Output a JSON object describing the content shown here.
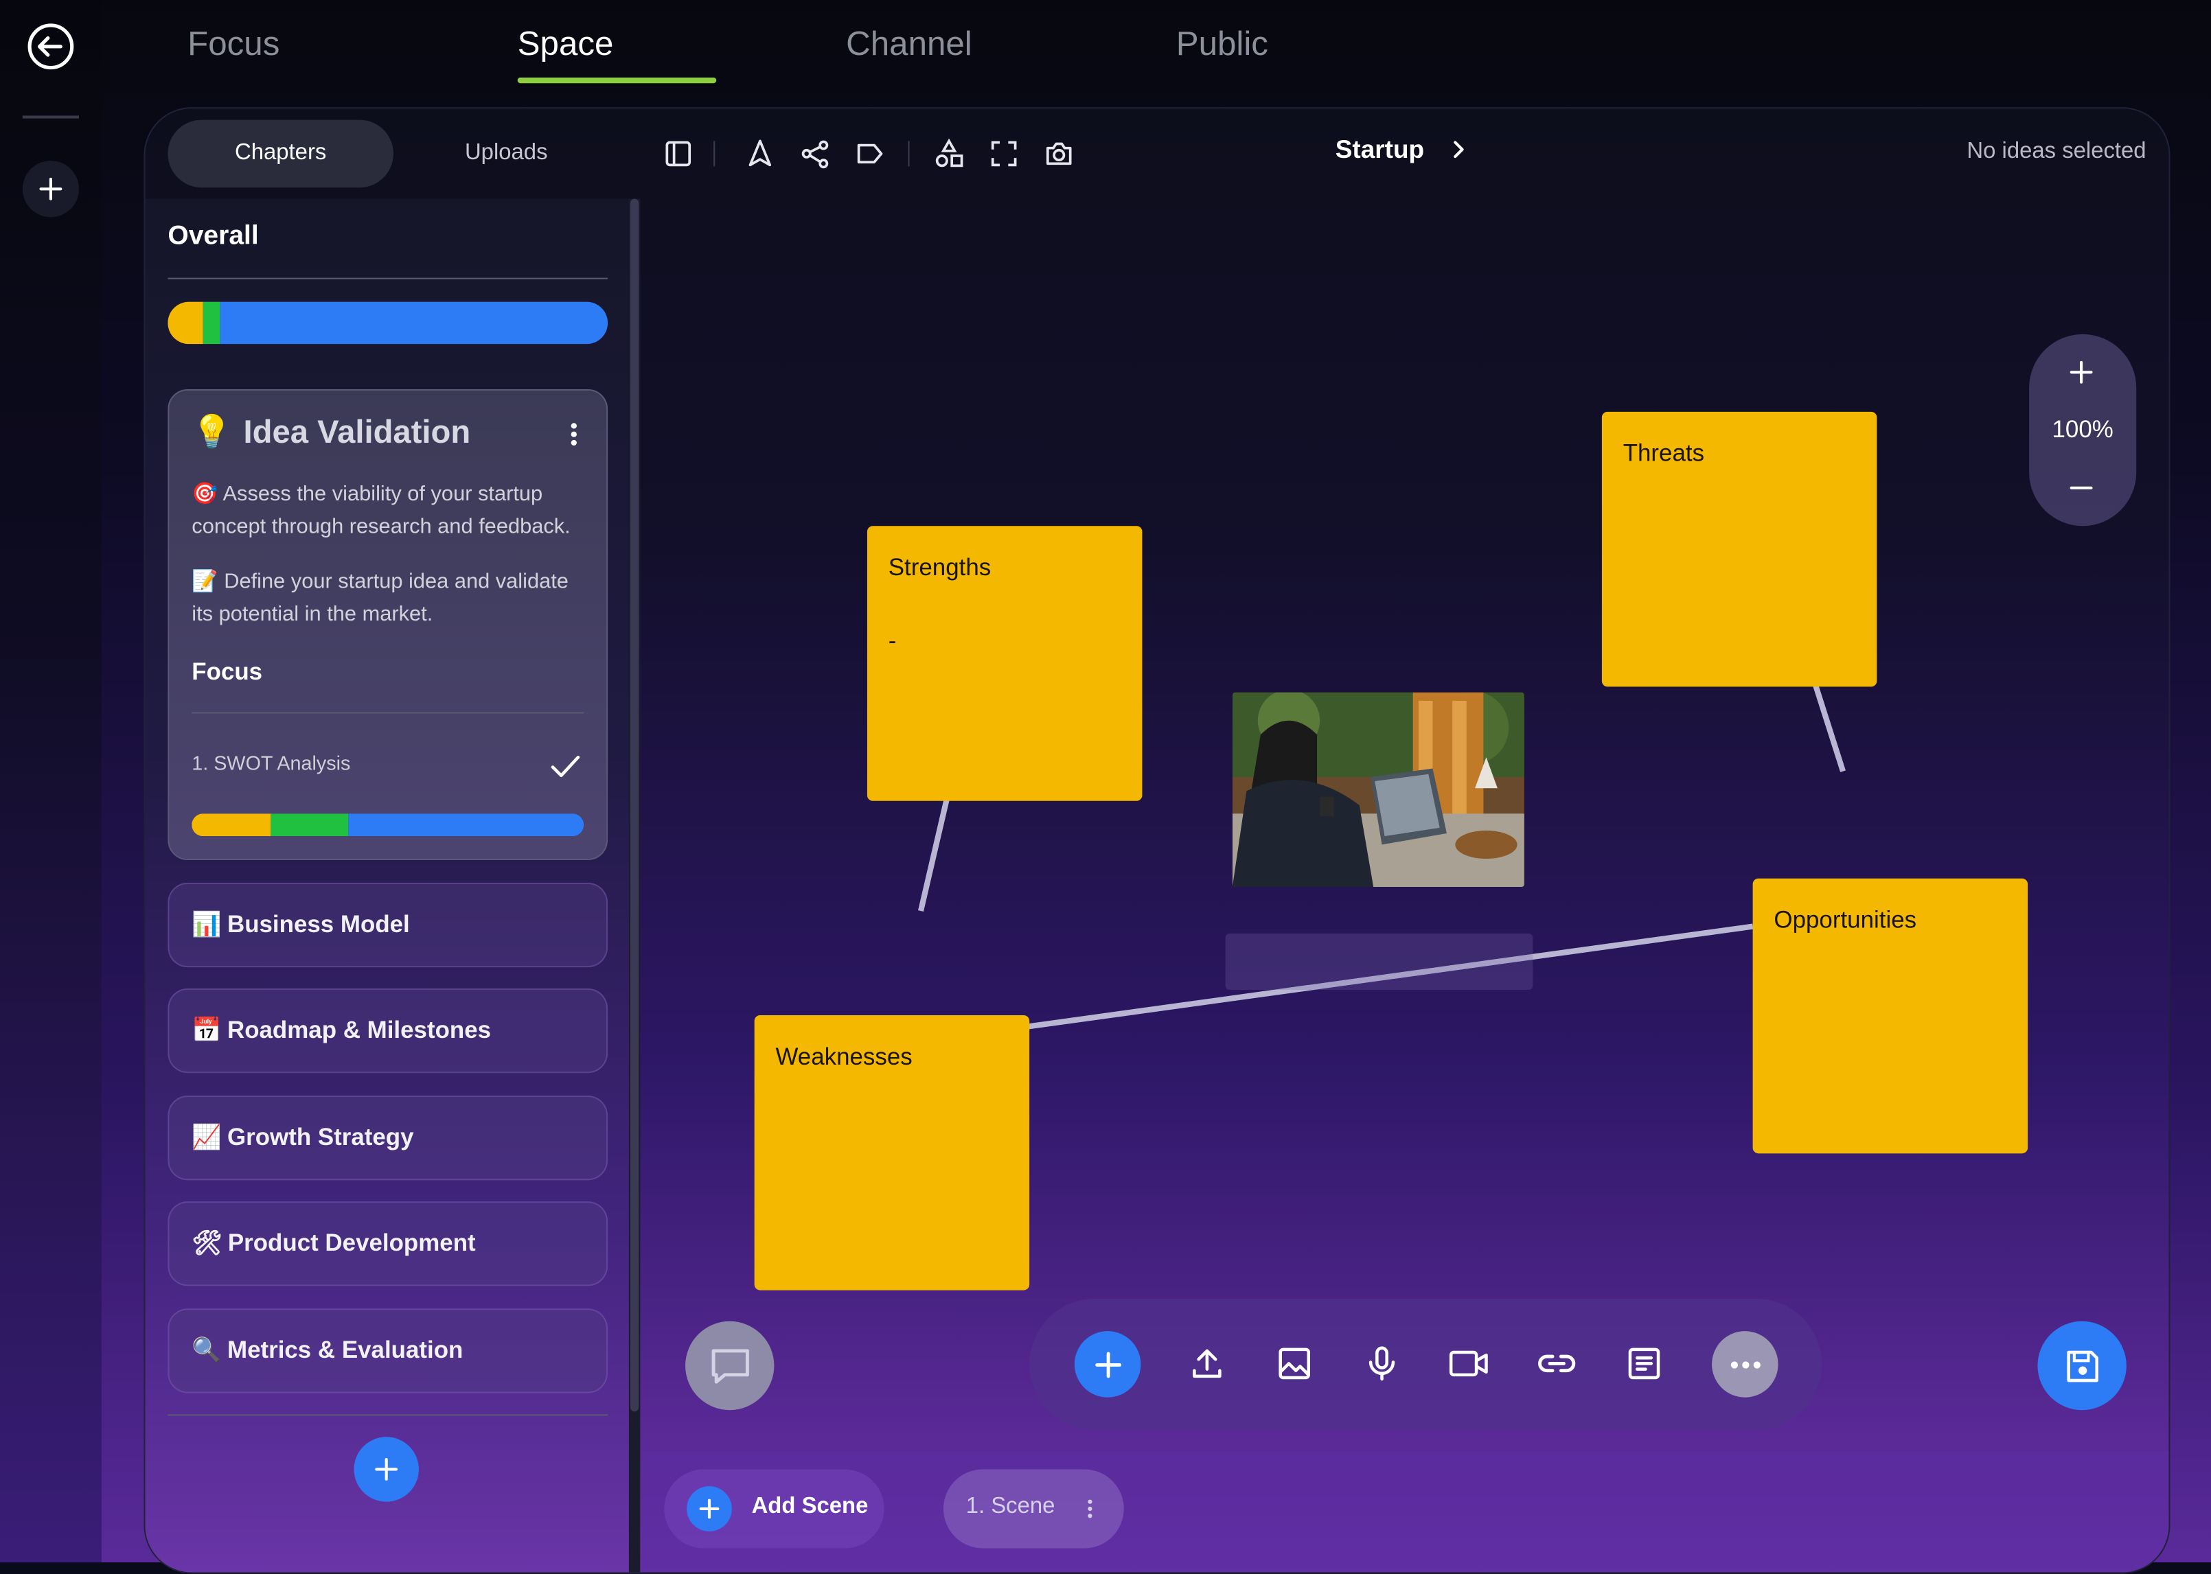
{
  "nav": {
    "tabs": [
      {
        "label": "Focus"
      },
      {
        "label": "Space"
      },
      {
        "label": "Channel"
      },
      {
        "label": "Public"
      }
    ],
    "active_tab": "Space"
  },
  "toolbar": {
    "segments": [
      "Chapters",
      "Uploads"
    ],
    "active_segment": "Chapters",
    "breadcrumb": "Startup",
    "selection_status": "No ideas selected",
    "tool_icons": [
      "sidebar-toggle-icon",
      "pointer-icon",
      "connect-icon",
      "tag-icon",
      "shapes-icon",
      "fullscreen-icon",
      "camera-icon"
    ]
  },
  "sidebar": {
    "overall_title": "Overall",
    "overall_progress": [
      {
        "color": "#f5b800",
        "fraction": 0.08
      },
      {
        "color": "#20c040",
        "fraction": 0.04
      },
      {
        "color": "#2d7cf6",
        "fraction": 0.88
      }
    ],
    "active_chapter": {
      "emoji": "💡",
      "title": "Idea Validation",
      "desc1": "🎯 Assess the viability of your startup concept through research and feedback.",
      "desc2": "📝 Define your startup idea and validate its potential in the market.",
      "focus_label": "Focus",
      "focus_item": "1. SWOT Analysis",
      "focus_progress": [
        {
          "color": "#f5b800",
          "fraction": 0.2
        },
        {
          "color": "#20c040",
          "fraction": 0.2
        },
        {
          "color": "#2d7cf6",
          "fraction": 0.6
        }
      ]
    },
    "chapters": [
      {
        "emoji": "📊",
        "label": "Business Model"
      },
      {
        "emoji": "📅",
        "label": "Roadmap & Milestones"
      },
      {
        "emoji": "📈",
        "label": "Growth Strategy"
      },
      {
        "emoji": "🛠",
        "label": "Product Development"
      },
      {
        "emoji": "🔍",
        "label": "Metrics & Evaluation"
      }
    ]
  },
  "canvas": {
    "zoom": "100%",
    "notes": [
      {
        "id": "strengths",
        "title": "Strengths",
        "body": "-"
      },
      {
        "id": "threats",
        "title": "Threats",
        "body": ""
      },
      {
        "id": "opportunities",
        "title": "Opportunities",
        "body": ""
      },
      {
        "id": "weaknesses",
        "title": "Weaknesses",
        "body": ""
      }
    ]
  },
  "bottom_tools": [
    "add-icon",
    "upload-icon",
    "image-icon",
    "microphone-icon",
    "video-icon",
    "link-icon",
    "note-icon",
    "more-icon"
  ],
  "scenes": {
    "add_label": "Add Scene",
    "items": [
      "1. Scene"
    ]
  },
  "colors": {
    "accent_blue": "#2d7cf6",
    "note_yellow": "#f5b800",
    "tab_underline": "#8ccf3f"
  }
}
